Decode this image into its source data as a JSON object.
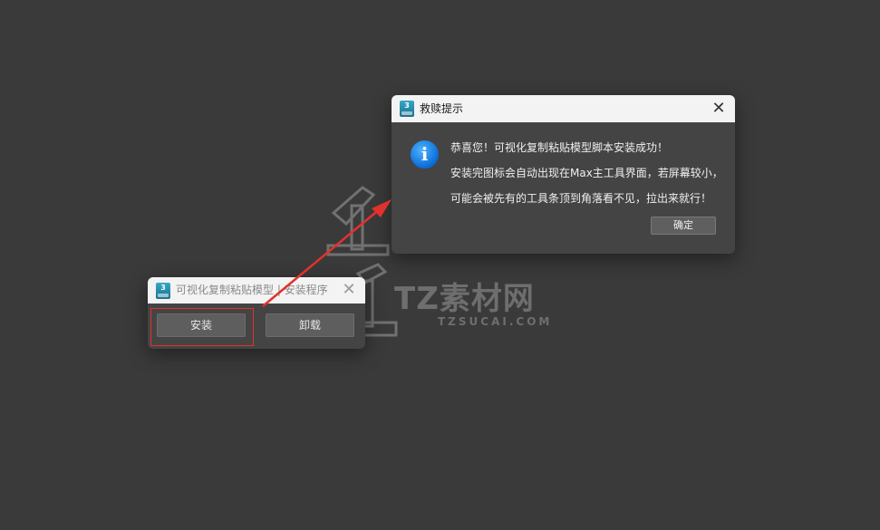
{
  "installer": {
    "icon_label": "3",
    "title": "可视化复制粘贴模型 | 安装程序",
    "install_label": "安装",
    "uninstall_label": "卸载",
    "close_glyph": "✕"
  },
  "dialog": {
    "icon_label": "3",
    "title": "救赎提示",
    "close_glyph": "✕",
    "info_glyph": "i",
    "lines": [
      "恭喜您！可视化复制粘贴模型脚本安装成功！",
      "安装完图标会自动出现在Max主工具界面，若屏幕较小，",
      "可能会被先有的工具条顶到角落看不见，拉出来就行！"
    ],
    "ok_label": "确定"
  },
  "watermark": {
    "brand": "TZ素材网",
    "domain": "TZSUCAI.COM"
  },
  "colors": {
    "background": "#3a3a3a",
    "window_body": "#444444",
    "titlebar": "#f3f3f3",
    "highlight_red": "#e0322d",
    "info_blue": "#0a6bd6"
  }
}
